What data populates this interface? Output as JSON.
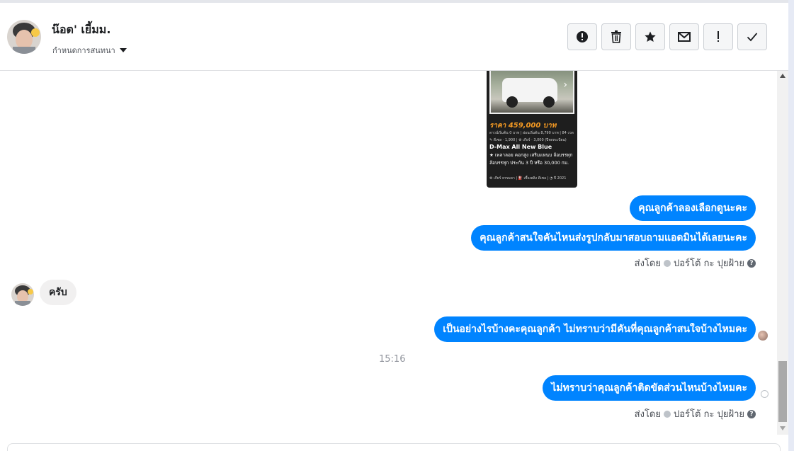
{
  "header": {
    "contact_name": "น๊อต' เยี้มม.",
    "assign_label": "กำหนดการสนทนา",
    "actions": [
      {
        "name": "spam-button",
        "icon": "alert-circle-icon"
      },
      {
        "name": "delete-button",
        "icon": "trash-icon"
      },
      {
        "name": "star-button",
        "icon": "star-icon"
      },
      {
        "name": "mark-unread-button",
        "icon": "envelope-icon"
      },
      {
        "name": "follow-up-button",
        "icon": "exclamation-icon"
      },
      {
        "name": "mark-done-button",
        "icon": "check-icon"
      }
    ]
  },
  "card": {
    "price": "ราคา 459,000 บาท",
    "line1": "ดาวน์เริ่มต้น 0 บาท | ผ่อนเริ่มต้น 8,790 บาท | 84 งวด",
    "line2": "✎ ดีเซล · 1,900 | ⚙ เกียร์ · 3,000 (ปีจดทะเบียน)",
    "title": "D-Max All New Blue",
    "desc": "★ เพลาลอย คอกสูง เสริมแหนบ ล้อบรรทุก ล้อบรรทุก ประกัน 3 ปี หรือ 30,000 กม.",
    "footer": "⚙ เกียร์ ธรรมดา | ⛽ เชื้อเพลิง ดีเซล | ◔ ปี 2021"
  },
  "messages": {
    "out1": "คุณลูกค้าลองเลือกดูนะคะ",
    "out2": "คุณลูกค้าสนใจคันไหนส่งรูปกลับมาสอบถามแอดมินได้เลยนะคะ",
    "in1": "ครับ",
    "out3": "เป็นอย่างไรบ้างคะคุณลูกค้า ไม่ทราบว่ามีคันที่คุณลูกค้าสนใจบ้างไหมคะ",
    "out4": "ไม่ทราบว่าคุณลูกค้าติดขัดส่วนไหนบ้างไหมคะ"
  },
  "sent_by": {
    "label": "ส่งโดย",
    "agent": "ปอร์โต้ กะ ปุยฝ้าย",
    "help": "?"
  },
  "timestamp": "15:16"
}
